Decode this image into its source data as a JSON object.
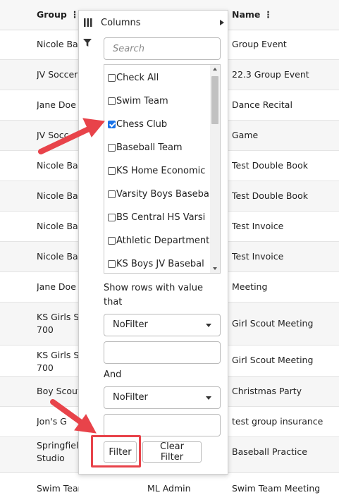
{
  "grid": {
    "headers": {
      "group": "Group",
      "name": "Name"
    },
    "rows": [
      {
        "group": "Nicole Bar",
        "name": "Group Event"
      },
      {
        "group": "JV Soccer",
        "name": "22.3 Group Event"
      },
      {
        "group": "Jane Doe",
        "name": "Dance Recital"
      },
      {
        "group": "JV Socc",
        "name": "Game"
      },
      {
        "group": "Nicole Bar",
        "name": "Test Double Book"
      },
      {
        "group": "Nicole Bar",
        "name": "Test Double Book"
      },
      {
        "group": "Nicole Bar",
        "name": "Test Invoice"
      },
      {
        "group": "Nicole Bar",
        "name": "Test Invoice"
      },
      {
        "group": "Jane Doe",
        "name": "Meeting"
      },
      {
        "group": "KS Girls S",
        "group2": "700",
        "name": "Girl Scout Meeting"
      },
      {
        "group": "KS Girls S",
        "group2": "700",
        "name": "Girl Scout Meeting"
      },
      {
        "group": "Boy Scout",
        "name": "Christmas Party"
      },
      {
        "group": "Jon's G",
        "name": "test group insurance"
      },
      {
        "group": "Springfiel",
        "group2": "Studio",
        "name": "Baseball Practice"
      },
      {
        "group": "Swim Team",
        "mid": "ML Admin",
        "name": "Swim Team Meeting"
      }
    ]
  },
  "filter_popup": {
    "columns_tab_label": "Columns",
    "search_placeholder": "Search",
    "options": [
      {
        "label": "Check All",
        "checked": false
      },
      {
        "label": "Swim Team",
        "checked": false
      },
      {
        "label": "Chess Club",
        "checked": true
      },
      {
        "label": "Baseball Team",
        "checked": false
      },
      {
        "label": "KS Home Economic",
        "checked": false
      },
      {
        "label": "Varsity Boys Baseba",
        "checked": false
      },
      {
        "label": "BS Central HS Varsi",
        "checked": false
      },
      {
        "label": "Athletic Department",
        "checked": false
      },
      {
        "label": "KS Boys JV Basebal",
        "checked": false
      }
    ],
    "show_rows_label": "Show rows with value that",
    "condition1": "NoFilter",
    "value1": "",
    "and_label": "And",
    "condition2": "NoFilter",
    "value2": "",
    "filter_button": "Filter",
    "clear_button": "Clear Filter"
  },
  "colors": {
    "annotation": "#e8434a",
    "checkbox_checked": "#1a73e8"
  },
  "icons": [
    "columns-icon",
    "funnel-icon",
    "kebab-menu-icon",
    "chevron-right-icon",
    "caret-down-icon"
  ]
}
